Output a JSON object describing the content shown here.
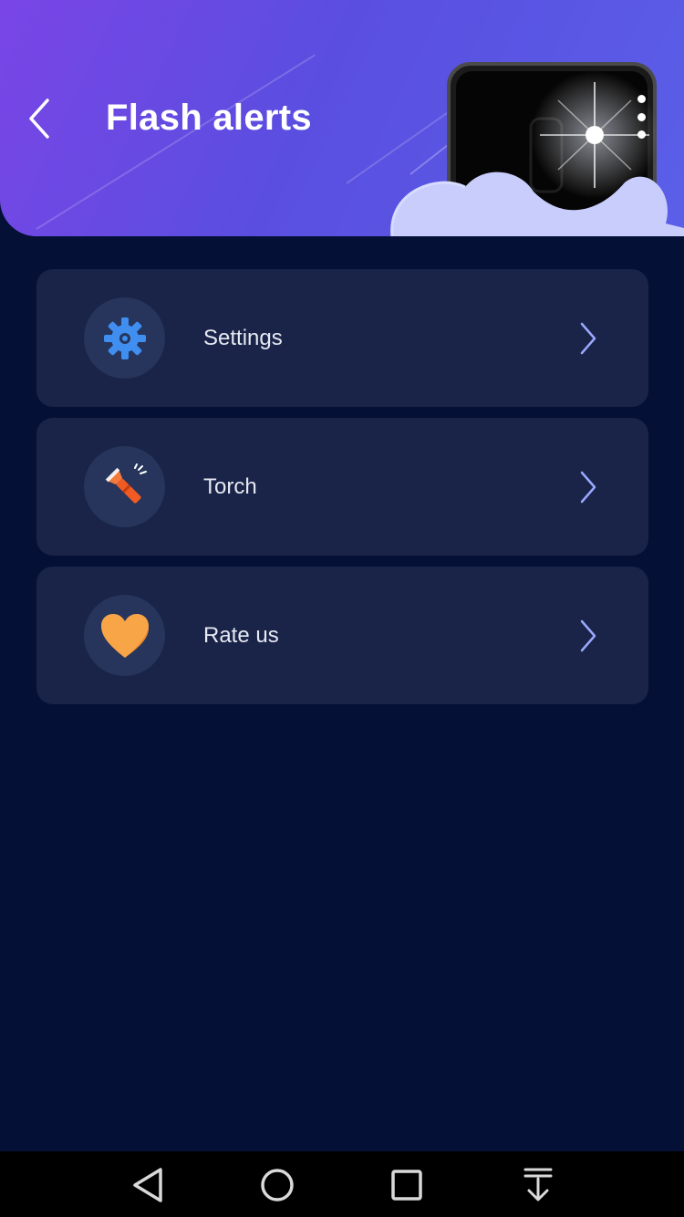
{
  "header": {
    "title": "Flash alerts",
    "back_icon": "chevron-left-icon",
    "menu_icon": "more-vertical-icon"
  },
  "menu": {
    "items": [
      {
        "label": "Settings",
        "icon": "gear-icon",
        "icon_color": "#3f8ef0"
      },
      {
        "label": "Torch",
        "icon": "flashlight-icon",
        "icon_color": "#f05a23"
      },
      {
        "label": "Rate us",
        "icon": "heart-icon",
        "icon_color": "#f8a548"
      }
    ]
  },
  "navbar": {
    "buttons": [
      "back-triangle-icon",
      "home-circle-icon",
      "recents-square-icon",
      "notification-pull-icon"
    ]
  },
  "colors": {
    "background": "#041035",
    "card": "#192448",
    "header_gradient_start": "#7a45e6",
    "header_gradient_end": "#5a5fe8"
  }
}
